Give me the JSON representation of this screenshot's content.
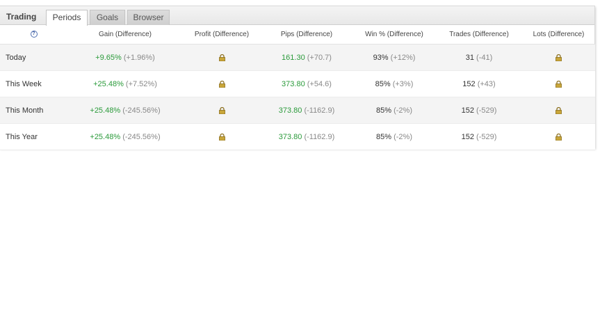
{
  "widget": {
    "title": "Trading",
    "tabs": [
      {
        "label": "Periods",
        "active": true
      },
      {
        "label": "Goals",
        "active": false
      },
      {
        "label": "Browser",
        "active": false
      }
    ]
  },
  "table": {
    "help_icon": "?",
    "headers": [
      "Gain (Difference)",
      "Profit (Difference)",
      "Pips (Difference)",
      "Win % (Difference)",
      "Trades (Difference)",
      "Lots (Difference)"
    ],
    "rows": [
      {
        "period": "Today",
        "gain": "+9.65%",
        "gain_diff": "(+1.96%)",
        "pips": "161.30",
        "pips_diff": "(+70.7)",
        "win": "93%",
        "win_diff": "(+12%)",
        "trades": "31",
        "trades_diff": "(-41)"
      },
      {
        "period": "This Week",
        "gain": "+25.48%",
        "gain_diff": "(+7.52%)",
        "pips": "373.80",
        "pips_diff": "(+54.6)",
        "win": "85%",
        "win_diff": "(+3%)",
        "trades": "152",
        "trades_diff": "(+43)"
      },
      {
        "period": "This Month",
        "gain": "+25.48%",
        "gain_diff": "(-245.56%)",
        "pips": "373.80",
        "pips_diff": "(-1162.9)",
        "win": "85%",
        "win_diff": "(-2%)",
        "trades": "152",
        "trades_diff": "(-529)"
      },
      {
        "period": "This Year",
        "gain": "+25.48%",
        "gain_diff": "(-245.56%)",
        "pips": "373.80",
        "pips_diff": "(-1162.9)",
        "win": "85%",
        "win_diff": "(-2%)",
        "trades": "152",
        "trades_diff": "(-529)"
      }
    ]
  },
  "colors": {
    "positive": "#2a9a3a",
    "difference": "#888888",
    "lock": "#b8952a"
  },
  "icons": {
    "help": "help-icon",
    "locked_value": "lock-icon"
  }
}
